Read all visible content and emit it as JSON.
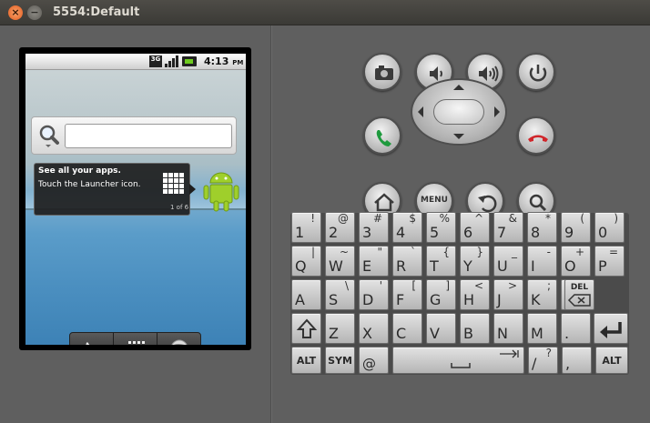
{
  "window": {
    "title": "5554:Default",
    "close_label": "×",
    "minimize_label": "−"
  },
  "status_bar": {
    "network": "3G",
    "time": "4:13",
    "ampm": "PM"
  },
  "launcher_tip": {
    "title": "See all your apps.",
    "body": "Touch the Launcher icon.",
    "page": "1 of 6"
  },
  "controls": {
    "menu_label": "MENU"
  },
  "keyboard": {
    "row1": [
      {
        "main": "1",
        "sub": "!"
      },
      {
        "main": "2",
        "sub": "@"
      },
      {
        "main": "3",
        "sub": "#"
      },
      {
        "main": "4",
        "sub": "$"
      },
      {
        "main": "5",
        "sub": "%"
      },
      {
        "main": "6",
        "sub": "^"
      },
      {
        "main": "7",
        "sub": "&"
      },
      {
        "main": "8",
        "sub": "*"
      },
      {
        "main": "9",
        "sub": "("
      },
      {
        "main": "0",
        "sub": ")"
      }
    ],
    "row2": [
      {
        "main": "Q",
        "sub": "|"
      },
      {
        "main": "W",
        "sub": "~"
      },
      {
        "main": "E",
        "sub": "\""
      },
      {
        "main": "R",
        "sub": "`"
      },
      {
        "main": "T",
        "sub": "{"
      },
      {
        "main": "Y",
        "sub": "}"
      },
      {
        "main": "U",
        "sub": "_"
      },
      {
        "main": "I",
        "sub": "-"
      },
      {
        "main": "O",
        "sub": "+"
      },
      {
        "main": "P",
        "sub": "="
      }
    ],
    "row3": [
      {
        "main": "A",
        "sub": ""
      },
      {
        "main": "S",
        "sub": "\\"
      },
      {
        "main": "D",
        "sub": "'"
      },
      {
        "main": "F",
        "sub": "["
      },
      {
        "main": "G",
        "sub": "]"
      },
      {
        "main": "H",
        "sub": "<"
      },
      {
        "main": "J",
        "sub": ">"
      },
      {
        "main": "K",
        "sub": ";"
      },
      {
        "main": "L",
        "sub": ":"
      }
    ],
    "del_label": "DEL",
    "row4": [
      {
        "main": "Z",
        "sub": ""
      },
      {
        "main": "X",
        "sub": ""
      },
      {
        "main": "C",
        "sub": ""
      },
      {
        "main": "V",
        "sub": ""
      },
      {
        "main": "B",
        "sub": ""
      },
      {
        "main": "N",
        "sub": ""
      },
      {
        "main": "M",
        "sub": ""
      },
      {
        "main": ".",
        "sub": ""
      }
    ],
    "alt_label": "ALT",
    "sym_label": "SYM",
    "at_label": "@",
    "slash_label": "/",
    "slash_sub": "?",
    "comma_label": ",",
    "alt_right_label": "ALT"
  }
}
